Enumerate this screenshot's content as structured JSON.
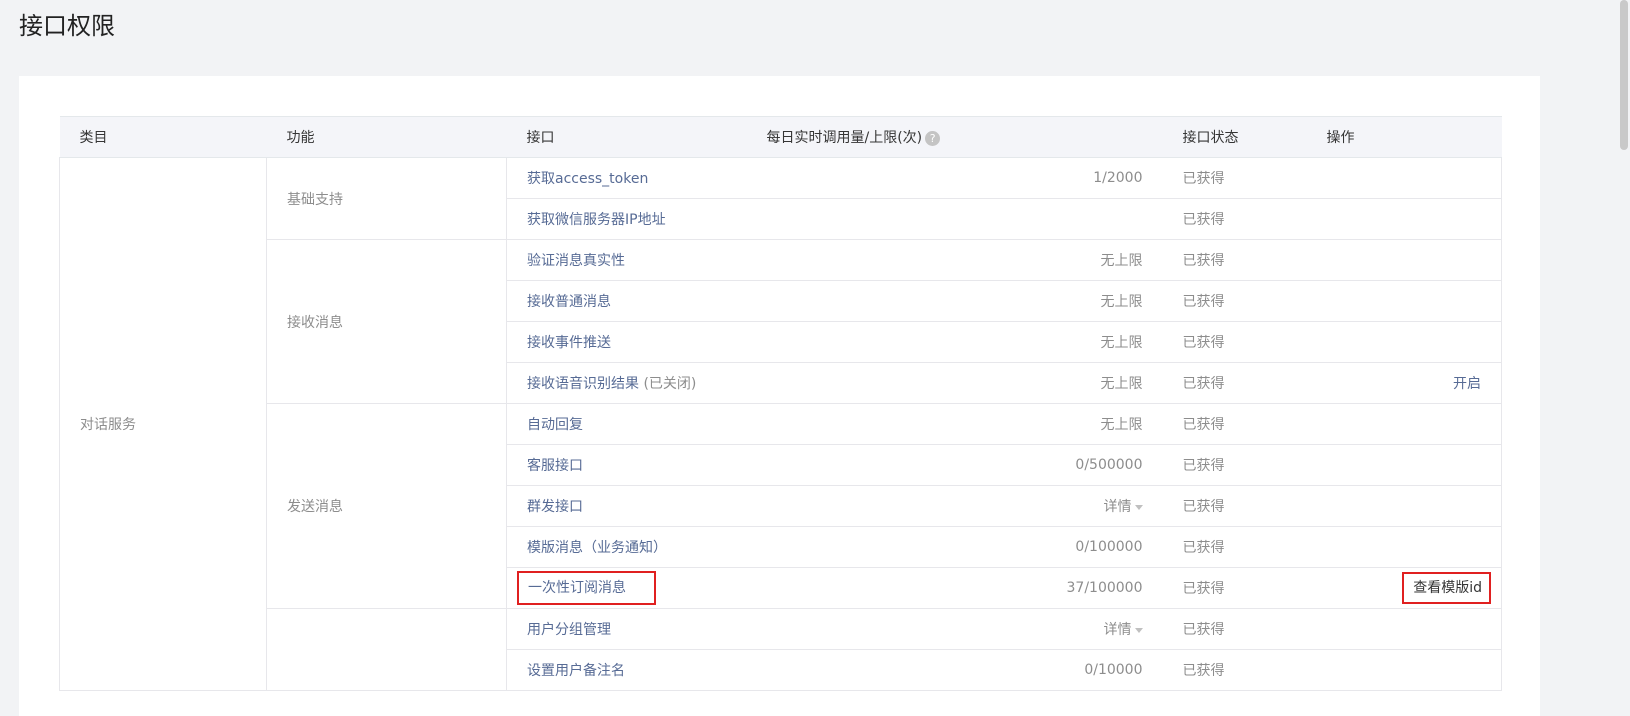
{
  "page": {
    "title": "接口权限"
  },
  "table": {
    "headers": {
      "category": "类目",
      "function": "功能",
      "api": "接口",
      "quota": "每日实时调用量/上限(次)",
      "status": "接口状态",
      "operation": "操作"
    },
    "category": "对话服务",
    "groups": [
      {
        "function": "基础支持",
        "rows": [
          {
            "api": "获取access_token",
            "note": "",
            "quota": "1/2000",
            "status": "已获得",
            "op": ""
          },
          {
            "api": "获取微信服务器IP地址",
            "note": "",
            "quota": "",
            "status": "已获得",
            "op": ""
          }
        ]
      },
      {
        "function": "接收消息",
        "rows": [
          {
            "api": "验证消息真实性",
            "note": "",
            "quota": "无上限",
            "status": "已获得",
            "op": ""
          },
          {
            "api": "接收普通消息",
            "note": "",
            "quota": "无上限",
            "status": "已获得",
            "op": ""
          },
          {
            "api": "接收事件推送",
            "note": "",
            "quota": "无上限",
            "status": "已获得",
            "op": ""
          },
          {
            "api": "接收语音识别结果",
            "note": " (已关闭)",
            "quota": "无上限",
            "status": "已获得",
            "op": "开启"
          }
        ]
      },
      {
        "function": "发送消息",
        "rows": [
          {
            "api": "自动回复",
            "note": "",
            "quota": "无上限",
            "status": "已获得",
            "op": ""
          },
          {
            "api": "客服接口",
            "note": "",
            "quota": "0/500000",
            "status": "已获得",
            "op": ""
          },
          {
            "api": "群发接口",
            "note": "",
            "quota": "详情",
            "status": "已获得",
            "op": ""
          },
          {
            "api": "模版消息（业务通知）",
            "note": "",
            "quota": "0/100000",
            "status": "已获得",
            "op": ""
          },
          {
            "api": "一次性订阅消息",
            "note": "",
            "quota": "37/100000",
            "status": "已获得",
            "op": "查看模版id"
          }
        ]
      },
      {
        "function": "",
        "rows": [
          {
            "api": "用户分组管理",
            "note": "",
            "quota": "详情",
            "status": "已获得",
            "op": ""
          },
          {
            "api": "设置用户备注名",
            "note": "",
            "quota": "0/10000",
            "status": "已获得",
            "op": ""
          }
        ]
      }
    ]
  },
  "colors": {
    "highlight": "#e02020",
    "link": "#576b95",
    "muted": "#8d8d8d"
  },
  "icons": {
    "help": "question-circle-icon",
    "caret": "caret-down-icon"
  }
}
